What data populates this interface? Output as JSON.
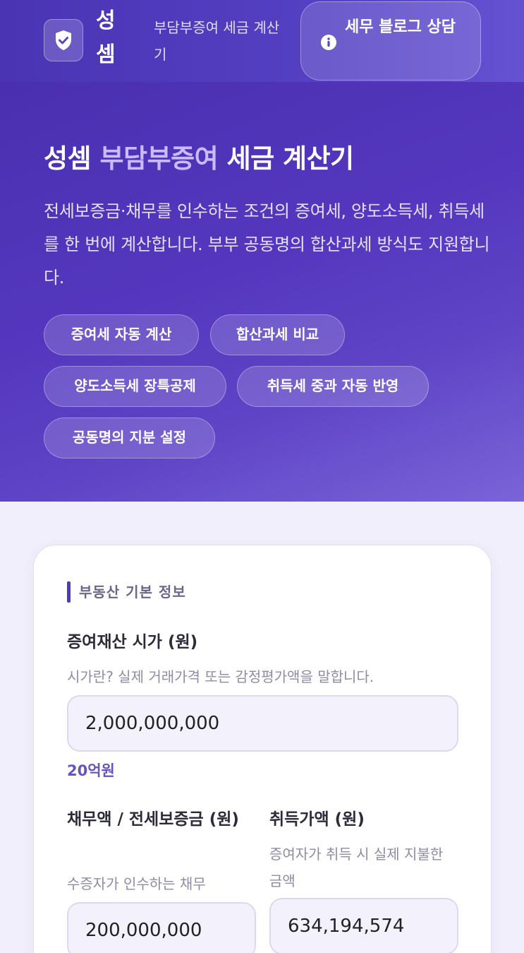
{
  "header": {
    "brand": "성셈",
    "subtitle": "부담부증여 세금 계산기",
    "blog_button": "세무 블로그 상담",
    "icons": {
      "logo": "shield-check-icon",
      "blog": "info-icon"
    }
  },
  "hero": {
    "title_brand": "성셈",
    "title_accent": "부담부증여",
    "title_rest": "세금 계산기",
    "description": "전세보증금·채무를 인수하는 조건의 증여세, 양도소득세, 취득세를 한 번에 계산합니다. 부부 공동명의 합산과세 방식도 지원합니다.",
    "chips": [
      "증여세 자동 계산",
      "합산과세 비교",
      "양도소득세 장특공제",
      "취득세 중과 자동 반영",
      "공동명의 지분 설정"
    ]
  },
  "form": {
    "section_title": "부동산 기본 정보",
    "market_value": {
      "label": "증여재산 시가 (원)",
      "help": "시가란? 실제 거래가격 또는 감정평가액을 말합니다.",
      "value": "2,000,000,000",
      "korean_amount": "20억원"
    },
    "debt": {
      "label": "채무액 / 전세보증금 (원)",
      "help": "수증자가 인수하는 채무",
      "value": "200,000,000"
    },
    "acquisition": {
      "label": "취득가액 (원)",
      "help": "증여자가 취득 시 실제 지불한 금액",
      "value": "634,194,574"
    }
  },
  "colors": {
    "brand_purple": "#4f3bb8",
    "accent_lavender": "#c8bbff",
    "page_bg": "#f1effb"
  }
}
